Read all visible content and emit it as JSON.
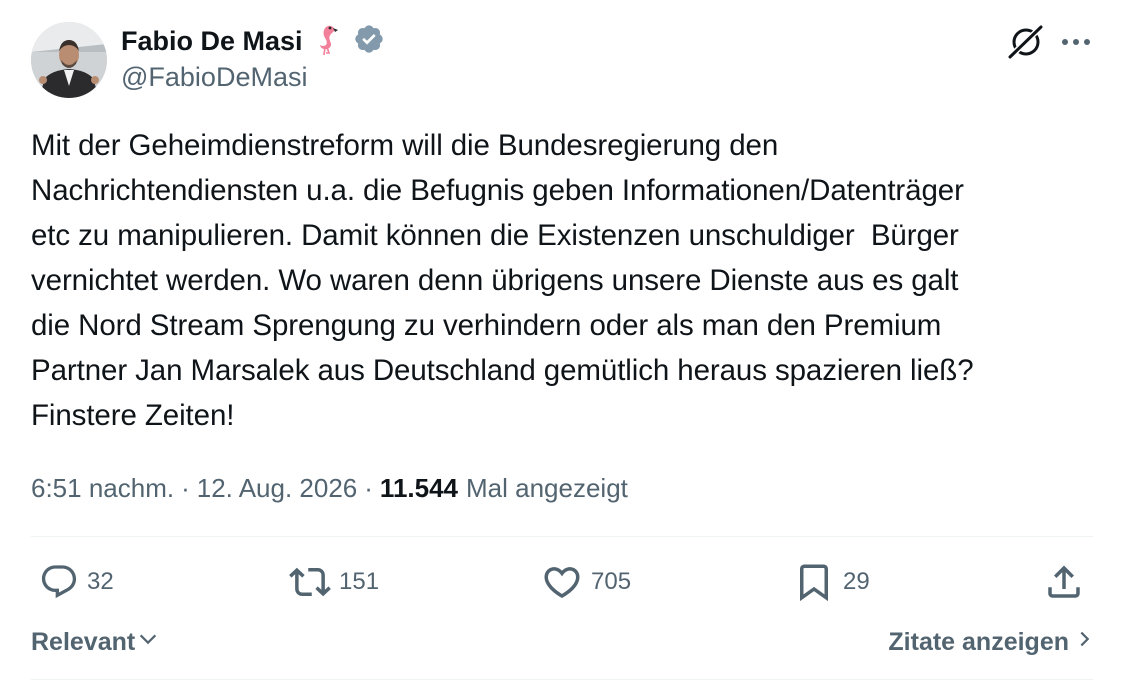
{
  "author": {
    "display_name": "Fabio De Masi",
    "handle": "@FabioDeMasi",
    "emoji_icon": "flamingo-icon",
    "verified_badge_color": "#829aab"
  },
  "tweet": {
    "text": "Mit der Geheimdienstreform will die Bundesregierung den\nNachrichtendiensten u.a. die Befugnis geben Informationen/Datenträger\netc zu manipulieren. Damit können die Existenzen unschuldiger  Bürger\nvernichtet werden. Wo waren denn übrigens unsere Dienste aus es galt\ndie Nord Stream Sprengung zu verhindern oder als man den Premium\nPartner Jan Marsalek aus Deutschland gemütlich heraus spazieren ließ?\nFinstere Zeiten!",
    "time": "6:51 nachm.",
    "separator": "·",
    "date": "12. Aug. 2026",
    "views_count": "11.544",
    "views_label": "Mal angezeigt"
  },
  "actions": {
    "replies": "32",
    "reposts": "151",
    "likes": "705",
    "bookmarks": "29"
  },
  "footer": {
    "sort_label": "Relevant",
    "quotes_label": "Zitate anzeigen"
  },
  "colors": {
    "text_primary": "#0f1419",
    "text_secondary": "#536471",
    "divider": "#eff3f4"
  }
}
